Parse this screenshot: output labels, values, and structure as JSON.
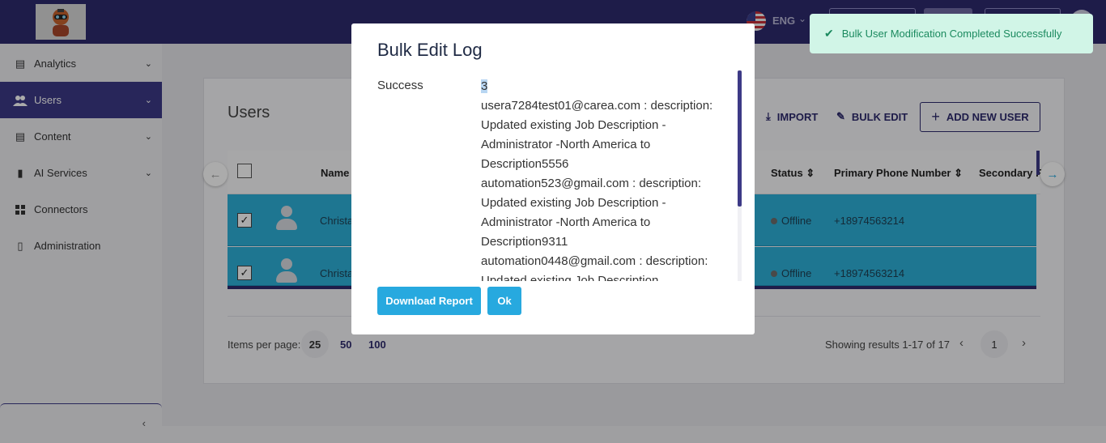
{
  "sidebar": {
    "items": [
      {
        "label": "Analytics",
        "icon": "table-icon",
        "active": false
      },
      {
        "label": "Users",
        "icon": "users-icon",
        "active": true
      },
      {
        "label": "Content",
        "icon": "table-icon",
        "active": false
      },
      {
        "label": "AI Services",
        "icon": "chip-icon",
        "active": false
      },
      {
        "label": "Connectors",
        "icon": "grid-icon",
        "active": false
      },
      {
        "label": "Administration",
        "icon": "document-icon",
        "active": false
      }
    ]
  },
  "header": {
    "language": "ENG"
  },
  "users_page": {
    "title": "Users",
    "import_label": "IMPORT",
    "bulk_edit_label": "BULK EDIT",
    "add_new_label": "ADD NEW USER",
    "columns": [
      "Name",
      "Status",
      "Primary Phone Number",
      "Secondary F"
    ],
    "rows": [
      {
        "name": "Christa",
        "status": "Offline",
        "phone": "+18974563214",
        "checked": "✓"
      },
      {
        "name": "Christa",
        "status": "Offline",
        "phone": "+18974563214",
        "checked": "✓"
      }
    ],
    "items_per_page_label": "Items per page:",
    "page_sizes": [
      "25",
      "50",
      "100"
    ],
    "showing": "Showing results 1-17 of 17",
    "current_page": "1"
  },
  "modal": {
    "title": "Bulk Edit Log",
    "success_label": "Success",
    "success_count": "3",
    "log_lines": [
      "usera7284test01@carea.com : description:",
      "Updated existing Job Description -",
      "Administrator -North America to",
      "Description5556",
      "automation523@gmail.com : description:",
      "Updated existing Job Description -",
      "Administrator -North America to",
      "Description9311",
      "automation0448@gmail.com : description:",
      "Updated existing Job Description"
    ],
    "download_label": "Download Report",
    "ok_label": "Ok"
  },
  "toast": {
    "message": "Bulk User Modification Completed Successfully"
  },
  "colors": {
    "brand": "#2e2a6e",
    "row_selected": "#2db0d8",
    "button": "#27a9df",
    "toast_bg": "#d1f5e7"
  }
}
